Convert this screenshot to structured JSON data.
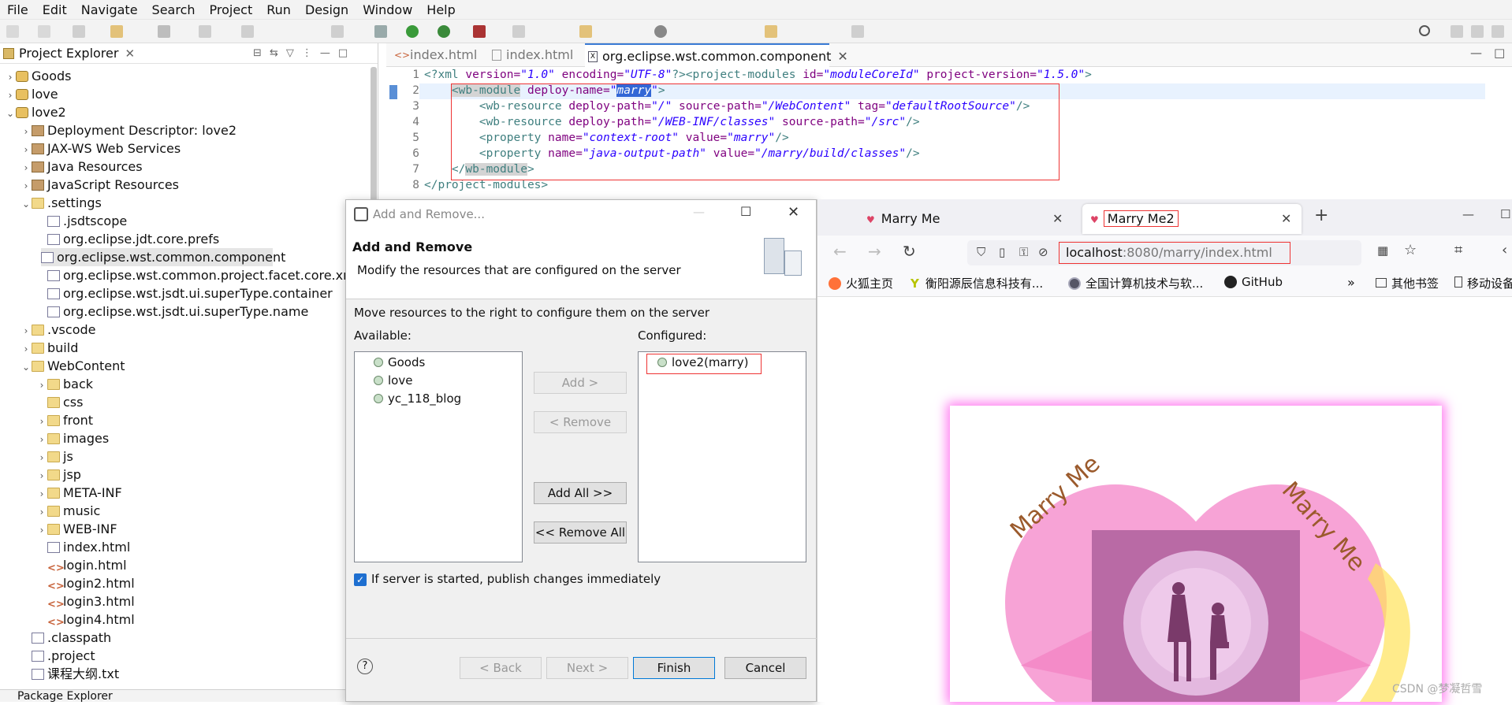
{
  "menu": [
    "File",
    "Edit",
    "Navigate",
    "Search",
    "Project",
    "Run",
    "Design",
    "Window",
    "Help"
  ],
  "explorer": {
    "title": "Project Explorer",
    "items": [
      {
        "label": "Goods",
        "indent": 0,
        "arrow": "›",
        "icon": "proj"
      },
      {
        "label": "love",
        "indent": 0,
        "arrow": "›",
        "icon": "proj"
      },
      {
        "label": "love2",
        "indent": 0,
        "arrow": "⌄",
        "icon": "proj"
      },
      {
        "label": "Deployment Descriptor: love2",
        "indent": 1,
        "arrow": "›",
        "icon": "jar"
      },
      {
        "label": "JAX-WS Web Services",
        "indent": 1,
        "arrow": "›",
        "icon": "jar"
      },
      {
        "label": "Java Resources",
        "indent": 1,
        "arrow": "›",
        "icon": "jar"
      },
      {
        "label": "JavaScript Resources",
        "indent": 1,
        "arrow": "›",
        "icon": "jar"
      },
      {
        "label": ".settings",
        "indent": 1,
        "arrow": "⌄",
        "icon": "folder"
      },
      {
        "label": ".jsdtscope",
        "indent": 2,
        "arrow": "",
        "icon": "file"
      },
      {
        "label": "org.eclipse.jdt.core.prefs",
        "indent": 2,
        "arrow": "",
        "icon": "file"
      },
      {
        "label": "org.eclipse.wst.common.component",
        "indent": 2,
        "arrow": "",
        "icon": "file",
        "selected": true
      },
      {
        "label": "org.eclipse.wst.common.project.facet.core.xml",
        "indent": 2,
        "arrow": "",
        "icon": "file"
      },
      {
        "label": "org.eclipse.wst.jsdt.ui.superType.container",
        "indent": 2,
        "arrow": "",
        "icon": "file"
      },
      {
        "label": "org.eclipse.wst.jsdt.ui.superType.name",
        "indent": 2,
        "arrow": "",
        "icon": "file"
      },
      {
        "label": ".vscode",
        "indent": 1,
        "arrow": "›",
        "icon": "folder"
      },
      {
        "label": "build",
        "indent": 1,
        "arrow": "›",
        "icon": "folder"
      },
      {
        "label": "WebContent",
        "indent": 1,
        "arrow": "⌄",
        "icon": "folder"
      },
      {
        "label": "back",
        "indent": 2,
        "arrow": "›",
        "icon": "folder"
      },
      {
        "label": "css",
        "indent": 2,
        "arrow": "",
        "icon": "folder"
      },
      {
        "label": "front",
        "indent": 2,
        "arrow": "›",
        "icon": "folder"
      },
      {
        "label": "images",
        "indent": 2,
        "arrow": "›",
        "icon": "folder"
      },
      {
        "label": "js",
        "indent": 2,
        "arrow": "›",
        "icon": "folder"
      },
      {
        "label": "jsp",
        "indent": 2,
        "arrow": "›",
        "icon": "folder"
      },
      {
        "label": "META-INF",
        "indent": 2,
        "arrow": "›",
        "icon": "folder"
      },
      {
        "label": "music",
        "indent": 2,
        "arrow": "›",
        "icon": "folder"
      },
      {
        "label": "WEB-INF",
        "indent": 2,
        "arrow": "›",
        "icon": "folder"
      },
      {
        "label": "index.html",
        "indent": 2,
        "arrow": "",
        "icon": "file"
      },
      {
        "label": "login.html",
        "indent": 2,
        "arrow": "",
        "icon": "html"
      },
      {
        "label": "login2.html",
        "indent": 2,
        "arrow": "",
        "icon": "html"
      },
      {
        "label": "login3.html",
        "indent": 2,
        "arrow": "",
        "icon": "html"
      },
      {
        "label": "login4.html",
        "indent": 2,
        "arrow": "",
        "icon": "html"
      },
      {
        "label": ".classpath",
        "indent": 1,
        "arrow": "",
        "icon": "file"
      },
      {
        "label": ".project",
        "indent": 1,
        "arrow": "",
        "icon": "file"
      },
      {
        "label": "课程大纲.txt",
        "indent": 1,
        "arrow": "",
        "icon": "file"
      }
    ],
    "bottom_title": "Package Explorer"
  },
  "editor": {
    "tabs": [
      "index.html",
      "index.html",
      "org.eclipse.wst.common.component"
    ],
    "line_numbers": [
      "1",
      "2",
      "3",
      "4",
      "5",
      "6",
      "7",
      "8"
    ]
  },
  "dialog": {
    "window_title": "Add and Remove...",
    "heading": "Add and Remove",
    "subheading": "Modify the resources that are configured on the server",
    "instruction": "Move resources to the right to configure them on the server",
    "available_label": "Available:",
    "configured_label": "Configured:",
    "available": [
      "Goods",
      "love",
      "yc_118_blog"
    ],
    "configured": [
      "love2(marry)"
    ],
    "add": "Add >",
    "remove": "< Remove",
    "add_all": "Add All >>",
    "remove_all": "<< Remove All",
    "publish_checkbox": "If server is started, publish changes immediately",
    "back": "< Back",
    "next": "Next >",
    "finish": "Finish",
    "cancel": "Cancel",
    "help": "?"
  },
  "browser": {
    "tab1": "Marry Me",
    "tab2": "Marry Me2",
    "url_host": "localhost",
    "url_rest": ":8080/marry/index.html",
    "bookmarks": [
      "火狐主页",
      "衡阳源辰信息科技有...",
      "全国计算机技术与软...",
      "GitHub",
      "其他书签",
      "移动设备"
    ],
    "overflow": "»",
    "card_text_left": "Marry Me",
    "card_text_right": "Marry Me"
  },
  "watermark": "CSDN @梦凝哲雪"
}
